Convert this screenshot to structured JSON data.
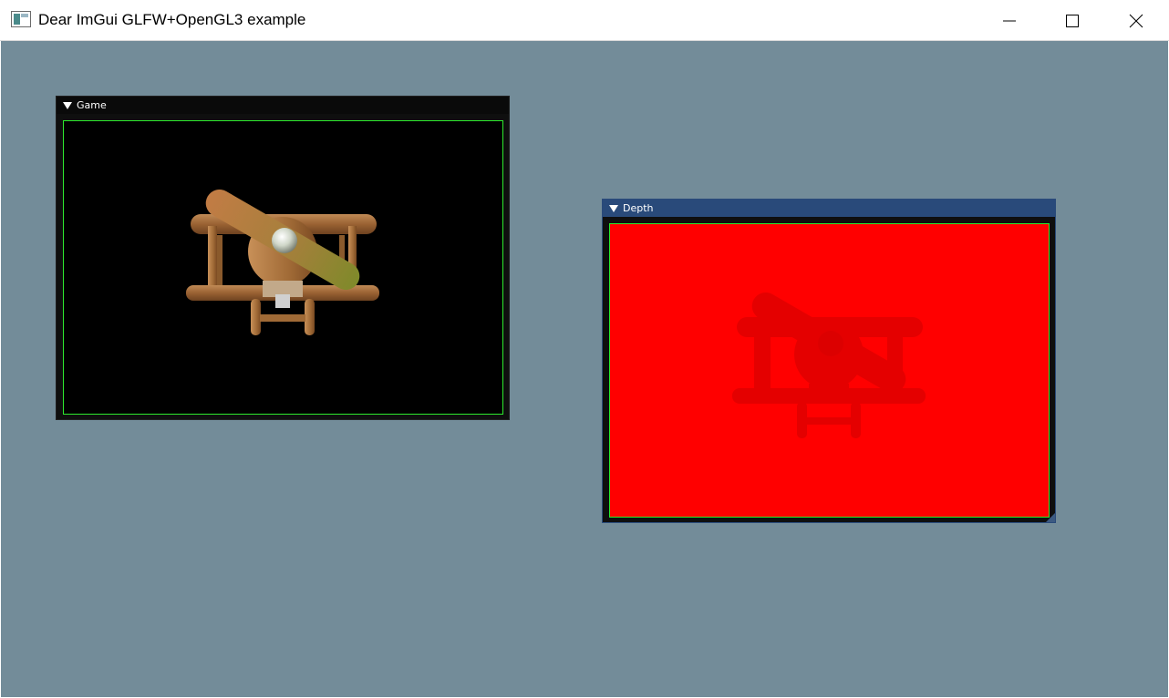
{
  "window": {
    "title": "Dear ImGui GLFW+OpenGL3 example",
    "minimize_icon": "minimize-icon",
    "maximize_icon": "maximize-icon",
    "close_icon": "close-icon",
    "app_icon": "app-icon"
  },
  "colors": {
    "desktop_background": "#738c99",
    "window_bg": "#0f0f0f",
    "title_inactive": "#0a0a0a",
    "title_active": "#294a7a",
    "viewport_border": "#2eea2e",
    "depth_fill": "#ff0000"
  },
  "panels": {
    "game": {
      "title": "Game",
      "collapse_icon": "triangle-down-icon",
      "content": "biplane-render"
    },
    "depth": {
      "title": "Depth",
      "collapse_icon": "triangle-down-icon",
      "content": "biplane-depth-map"
    }
  }
}
